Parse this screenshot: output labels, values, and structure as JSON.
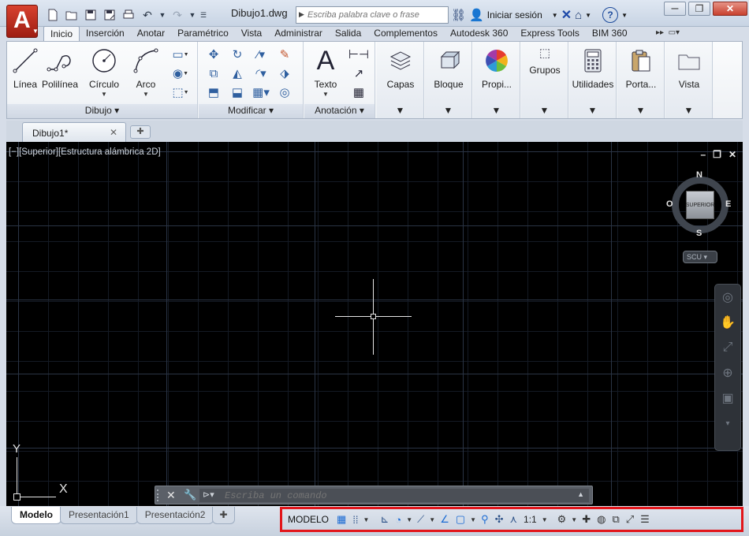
{
  "app": {
    "document_title": "Dibujo1.dwg",
    "logo_letter": "A"
  },
  "quick_access": [
    "new-icon",
    "open-icon",
    "save-icon",
    "save-as-icon",
    "plot-icon",
    "undo-icon",
    "redo-icon",
    "customize-icon"
  ],
  "search": {
    "placeholder": "Escriba palabra clave o frase"
  },
  "account": {
    "sign_in_label": "Iniciar sesión"
  },
  "ribbon_tabs": [
    "Inicio",
    "Inserción",
    "Anotar",
    "Paramétrico",
    "Vista",
    "Administrar",
    "Salida",
    "Complementos",
    "Autodesk 360",
    "Express Tools",
    "BIM 360"
  ],
  "ribbon": {
    "draw": {
      "title": "Dibujo",
      "line": "Línea",
      "polyline": "Polilínea",
      "circle": "Círculo",
      "arc": "Arco"
    },
    "modify": {
      "title": "Modificar"
    },
    "annotation": {
      "title": "Anotación",
      "text": "Texto"
    },
    "layers": "Capas",
    "block": "Bloque",
    "properties": "Propi...",
    "groups": "Grupos",
    "utilities": "Utilidades",
    "clipboard": "Porta...",
    "view": "Vista"
  },
  "document_tab": {
    "label": "Dibujo1*"
  },
  "viewport": {
    "label": "[−][Superior][Estructura alámbrica 2D]",
    "viewcube": {
      "face": "SUPERIOR",
      "north": "N",
      "south": "S",
      "east": "E",
      "west": "O",
      "ucs_label": "SCU"
    },
    "ucs_y": "Y",
    "ucs_x": "X"
  },
  "command_line": {
    "placeholder": "Escriba un comando"
  },
  "layout_tabs": [
    "Modelo",
    "Presentación1",
    "Presentación2"
  ],
  "status_bar": {
    "model_label": "MODELO",
    "annotation_scale": "1:1",
    "highlight_color": "#e2161b"
  }
}
